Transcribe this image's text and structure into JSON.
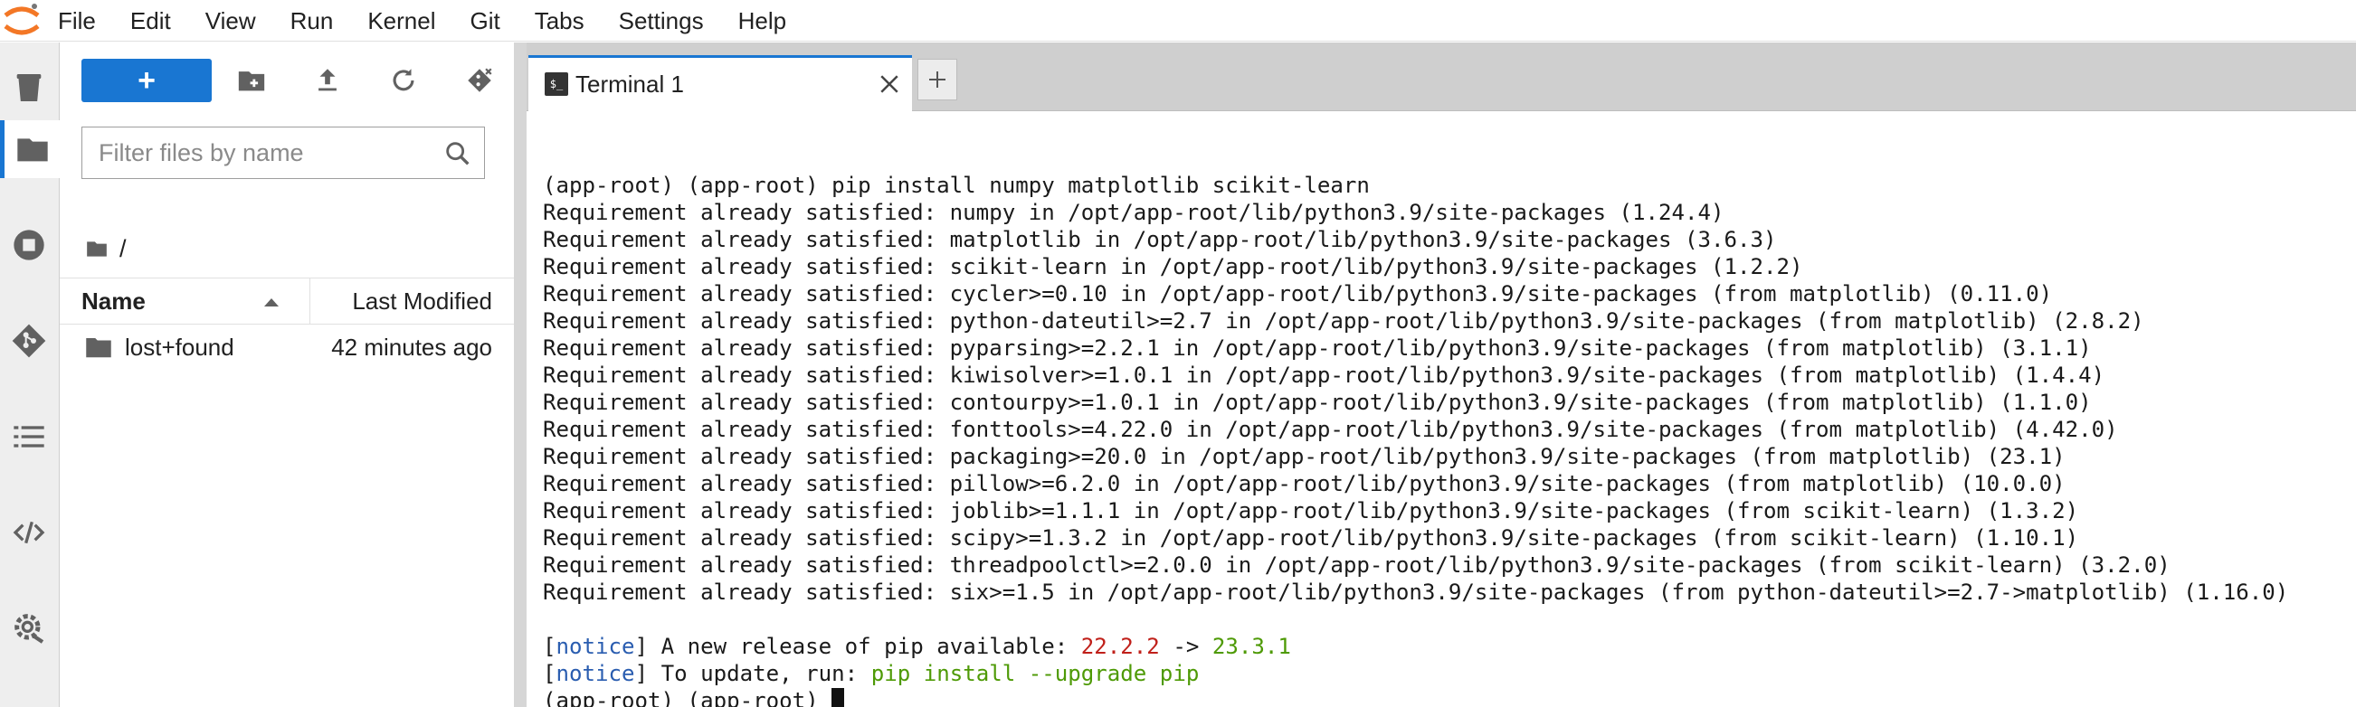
{
  "menubar": {
    "items": [
      "File",
      "Edit",
      "View",
      "Run",
      "Kernel",
      "Git",
      "Tabs",
      "Settings",
      "Help"
    ]
  },
  "activity_bar": {
    "icons": [
      "trash-icon",
      "folder-icon",
      "running-icon",
      "git-icon",
      "list-icon",
      "code-icon",
      "settings-icon"
    ],
    "accent": "#1976d2"
  },
  "file_browser": {
    "new_button_label": "+",
    "filter_placeholder": "Filter files by name",
    "breadcrumb": "/",
    "columns": {
      "name": "Name",
      "modified": "Last Modified"
    },
    "files": [
      {
        "name": "lost+found",
        "modified": "42 minutes ago",
        "type": "folder"
      }
    ]
  },
  "tabs": [
    {
      "label": "Terminal 1",
      "icon_text": "$_"
    }
  ],
  "terminal": {
    "lines": [
      "(app-root) (app-root) pip install numpy matplotlib scikit-learn",
      "Requirement already satisfied: numpy in /opt/app-root/lib/python3.9/site-packages (1.24.4)",
      "Requirement already satisfied: matplotlib in /opt/app-root/lib/python3.9/site-packages (3.6.3)",
      "Requirement already satisfied: scikit-learn in /opt/app-root/lib/python3.9/site-packages (1.2.2)",
      "Requirement already satisfied: cycler>=0.10 in /opt/app-root/lib/python3.9/site-packages (from matplotlib) (0.11.0)",
      "Requirement already satisfied: python-dateutil>=2.7 in /opt/app-root/lib/python3.9/site-packages (from matplotlib) (2.8.2)",
      "Requirement already satisfied: pyparsing>=2.2.1 in /opt/app-root/lib/python3.9/site-packages (from matplotlib) (3.1.1)",
      "Requirement already satisfied: kiwisolver>=1.0.1 in /opt/app-root/lib/python3.9/site-packages (from matplotlib) (1.4.4)",
      "Requirement already satisfied: contourpy>=1.0.1 in /opt/app-root/lib/python3.9/site-packages (from matplotlib) (1.1.0)",
      "Requirement already satisfied: fonttools>=4.22.0 in /opt/app-root/lib/python3.9/site-packages (from matplotlib) (4.42.0)",
      "Requirement already satisfied: packaging>=20.0 in /opt/app-root/lib/python3.9/site-packages (from matplotlib) (23.1)",
      "Requirement already satisfied: pillow>=6.2.0 in /opt/app-root/lib/python3.9/site-packages (from matplotlib) (10.0.0)",
      "Requirement already satisfied: joblib>=1.1.1 in /opt/app-root/lib/python3.9/site-packages (from scikit-learn) (1.3.2)",
      "Requirement already satisfied: scipy>=1.3.2 in /opt/app-root/lib/python3.9/site-packages (from scikit-learn) (1.10.1)",
      "Requirement already satisfied: threadpoolctl>=2.0.0 in /opt/app-root/lib/python3.9/site-packages (from scikit-learn) (3.2.0)",
      "Requirement already satisfied: six>=1.5 in /opt/app-root/lib/python3.9/site-packages (from python-dateutil>=2.7->matplotlib) (1.16.0)",
      ""
    ],
    "notice1": {
      "tag": "notice",
      "text": " A new release of pip available: ",
      "old": "22.2.2",
      "arrow": " -> ",
      "new": "23.3.1"
    },
    "notice2": {
      "tag": "notice",
      "text": " To update, run: ",
      "cmd": "pip install --upgrade pip"
    },
    "prompt": "(app-root) (app-root) "
  }
}
